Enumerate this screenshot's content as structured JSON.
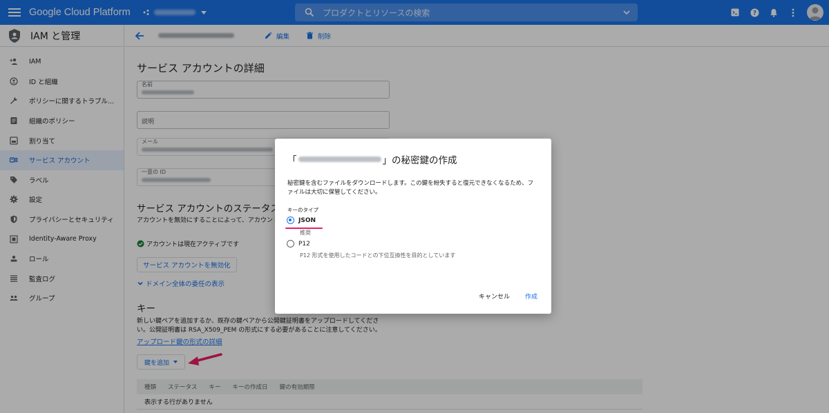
{
  "topbar": {
    "brand": "Google Cloud Platform",
    "search_placeholder": "プロダクトとリソースの検索",
    "icons": [
      "terminal-icon",
      "help-icon",
      "notifications-icon",
      "more-icon",
      "account-avatar-icon"
    ]
  },
  "sidebar": {
    "title": "IAM と管理",
    "items": [
      {
        "label": "IAM",
        "icon": "person-add-icon"
      },
      {
        "label": "ID と組織",
        "icon": "account-circle-icon"
      },
      {
        "label": "ポリシーに関するトラブル...",
        "icon": "wrench-icon"
      },
      {
        "label": "組織のポリシー",
        "icon": "policy-icon"
      },
      {
        "label": "割り当て",
        "icon": "quota-icon"
      },
      {
        "label": "サービス アカウント",
        "icon": "service-account-icon",
        "active": true
      },
      {
        "label": "ラベル",
        "icon": "label-icon"
      },
      {
        "label": "設定",
        "icon": "gear-icon"
      },
      {
        "label": "プライバシーとセキュリティ",
        "icon": "shield-icon"
      },
      {
        "label": "Identity-Aware Proxy",
        "icon": "iap-icon"
      },
      {
        "label": "ロール",
        "icon": "roles-icon"
      },
      {
        "label": "監査ログ",
        "icon": "audit-log-icon"
      },
      {
        "label": "グループ",
        "icon": "groups-icon"
      }
    ]
  },
  "header": {
    "edit_label": "編集",
    "delete_label": "削除"
  },
  "details": {
    "title": "サービス アカウントの詳細",
    "name_label": "名前",
    "description_placeholder": "説明",
    "email_label": "メール",
    "unique_id_label": "一意の ID"
  },
  "status_section": {
    "title": "サービス アカウントのステータス",
    "description": "アカウントを無効にすることによって、アカウント",
    "active_text": "アカウントは現在アクティブです",
    "disable_button": "サービス アカウントを無効化",
    "delegation_link": "ドメイン全体の委任の表示"
  },
  "keys_section": {
    "title": "キー",
    "description_line1": "新しい鍵ペアを追加するか、既存の鍵ペアから公開鍵証明書をアップロードしてくださ",
    "description_line2": "い。公開証明書は RSA_X509_PEM の形式にする必要があることに注意してください。",
    "upload_link": "アップロード鍵の形式の詳細",
    "add_key_button": "鍵を追加",
    "table_headers": [
      "種類",
      "ステータス",
      "キー",
      "キーの作成日",
      "鍵の有効期限"
    ],
    "empty_text": "表示する行がありません"
  },
  "dialog": {
    "title_prefix": "「",
    "title_suffix": "」の秘密鍵の作成",
    "description": "秘密鍵を含むファイルをダウンロードします。この鍵を紛失すると復元できなくなるため、ファイルは大切に保管してください。",
    "key_type_label": "キーのタイプ",
    "options": [
      {
        "label": "JSON",
        "sub": "推奨",
        "selected": true
      },
      {
        "label": "P12",
        "sub": "P12 形式を使用したコードとの下位互換性を目的としています",
        "selected": false
      }
    ],
    "cancel_label": "キャンセル",
    "create_label": "作成"
  },
  "colors": {
    "primary": "#1a73e8",
    "highlight": "#e91e63",
    "active_bg": "#e8f0fe"
  }
}
